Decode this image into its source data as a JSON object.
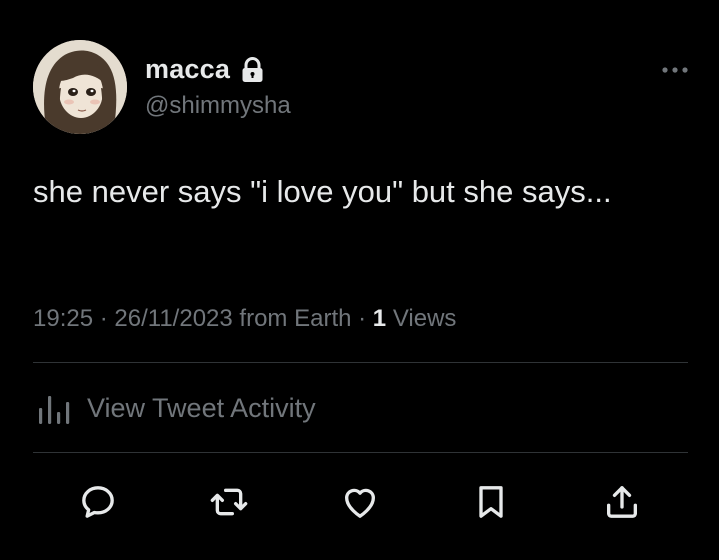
{
  "user": {
    "display_name": "macca",
    "handle": "@shimmysha",
    "protected_icon": "lock-icon",
    "avatar": "avatar"
  },
  "tweet": {
    "text": "she never says \"i love you\" but she says...",
    "time": "19:25",
    "date": "26/11/2023",
    "source": "from Earth",
    "views_count": "1",
    "views_label": "Views"
  },
  "activity": {
    "label": "View Tweet Activity",
    "icon": "analytics-icon"
  },
  "actions": {
    "reply": "reply-icon",
    "retweet": "retweet-icon",
    "like": "heart-icon",
    "bookmark": "bookmark-icon",
    "share": "share-icon"
  },
  "colors": {
    "background": "#000000",
    "primary_text": "#e7e9ea",
    "secondary_text": "#71767b",
    "divider": "#2f3336"
  }
}
